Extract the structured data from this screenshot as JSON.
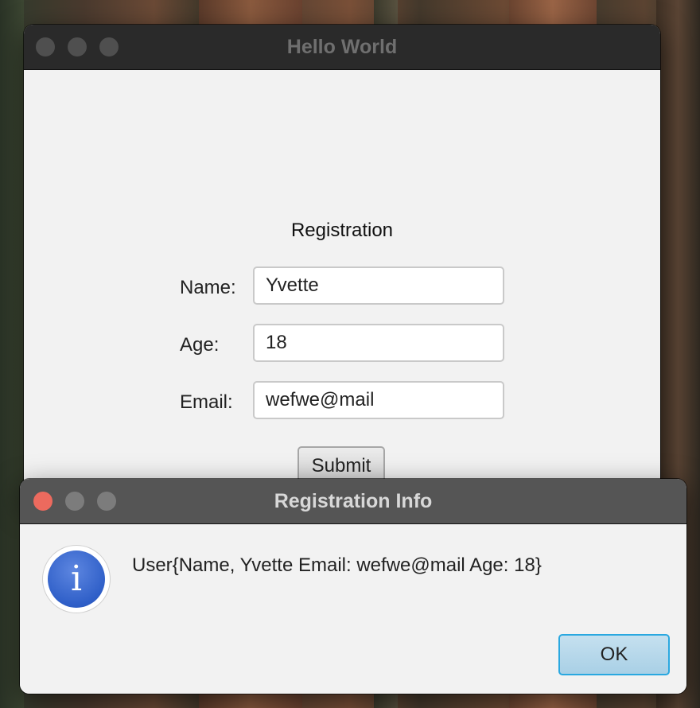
{
  "main_window": {
    "title": "Hello World",
    "heading": "Registration",
    "fields": [
      {
        "label": "Name:",
        "value": "Yvette"
      },
      {
        "label": "Age:",
        "value": "18"
      },
      {
        "label": "Email:",
        "value": "wefwe@mail"
      }
    ],
    "submit_label": "Submit"
  },
  "dialog": {
    "title": "Registration Info",
    "icon": "info-icon",
    "message": "User{Name, Yvette Email: wefwe@mail Age: 18}",
    "ok_label": "OK"
  },
  "colors": {
    "titlebar_main": "#2a2a2a",
    "titlebar_dialog": "#555555",
    "close_red": "#ec6a5e",
    "ok_focus_border": "#2aa8e0",
    "info_blue": "#2f5fc8"
  }
}
